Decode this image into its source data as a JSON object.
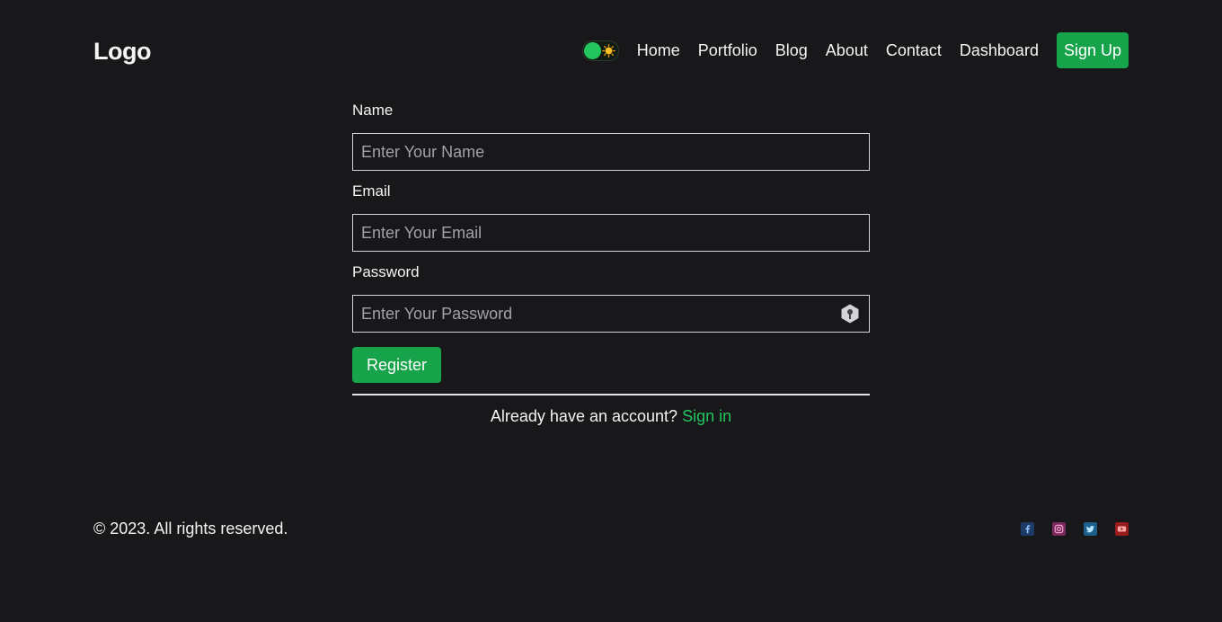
{
  "header": {
    "logo": "Logo",
    "nav": [
      "Home",
      "Portfolio",
      "Blog",
      "About",
      "Contact",
      "Dashboard"
    ],
    "signup_label": "Sign Up",
    "theme_toggle_icon": "sun-icon"
  },
  "form": {
    "name_label": "Name",
    "name_placeholder": "Enter Your Name",
    "email_label": "Email",
    "email_placeholder": "Enter Your Email",
    "password_label": "Password",
    "password_placeholder": "Enter Your Password",
    "password_icon": "key-icon",
    "register_label": "Register",
    "signin_prompt": "Already have an account?",
    "signin_link": "Sign in"
  },
  "footer": {
    "copyright": "© 2023. All rights reserved.",
    "socials": [
      "facebook-icon",
      "instagram-icon",
      "twitter-icon",
      "youtube-icon"
    ]
  },
  "colors": {
    "background": "#18181b",
    "accent": "#16a34a",
    "link": "#22c55e",
    "text": "#f4f4f5"
  }
}
